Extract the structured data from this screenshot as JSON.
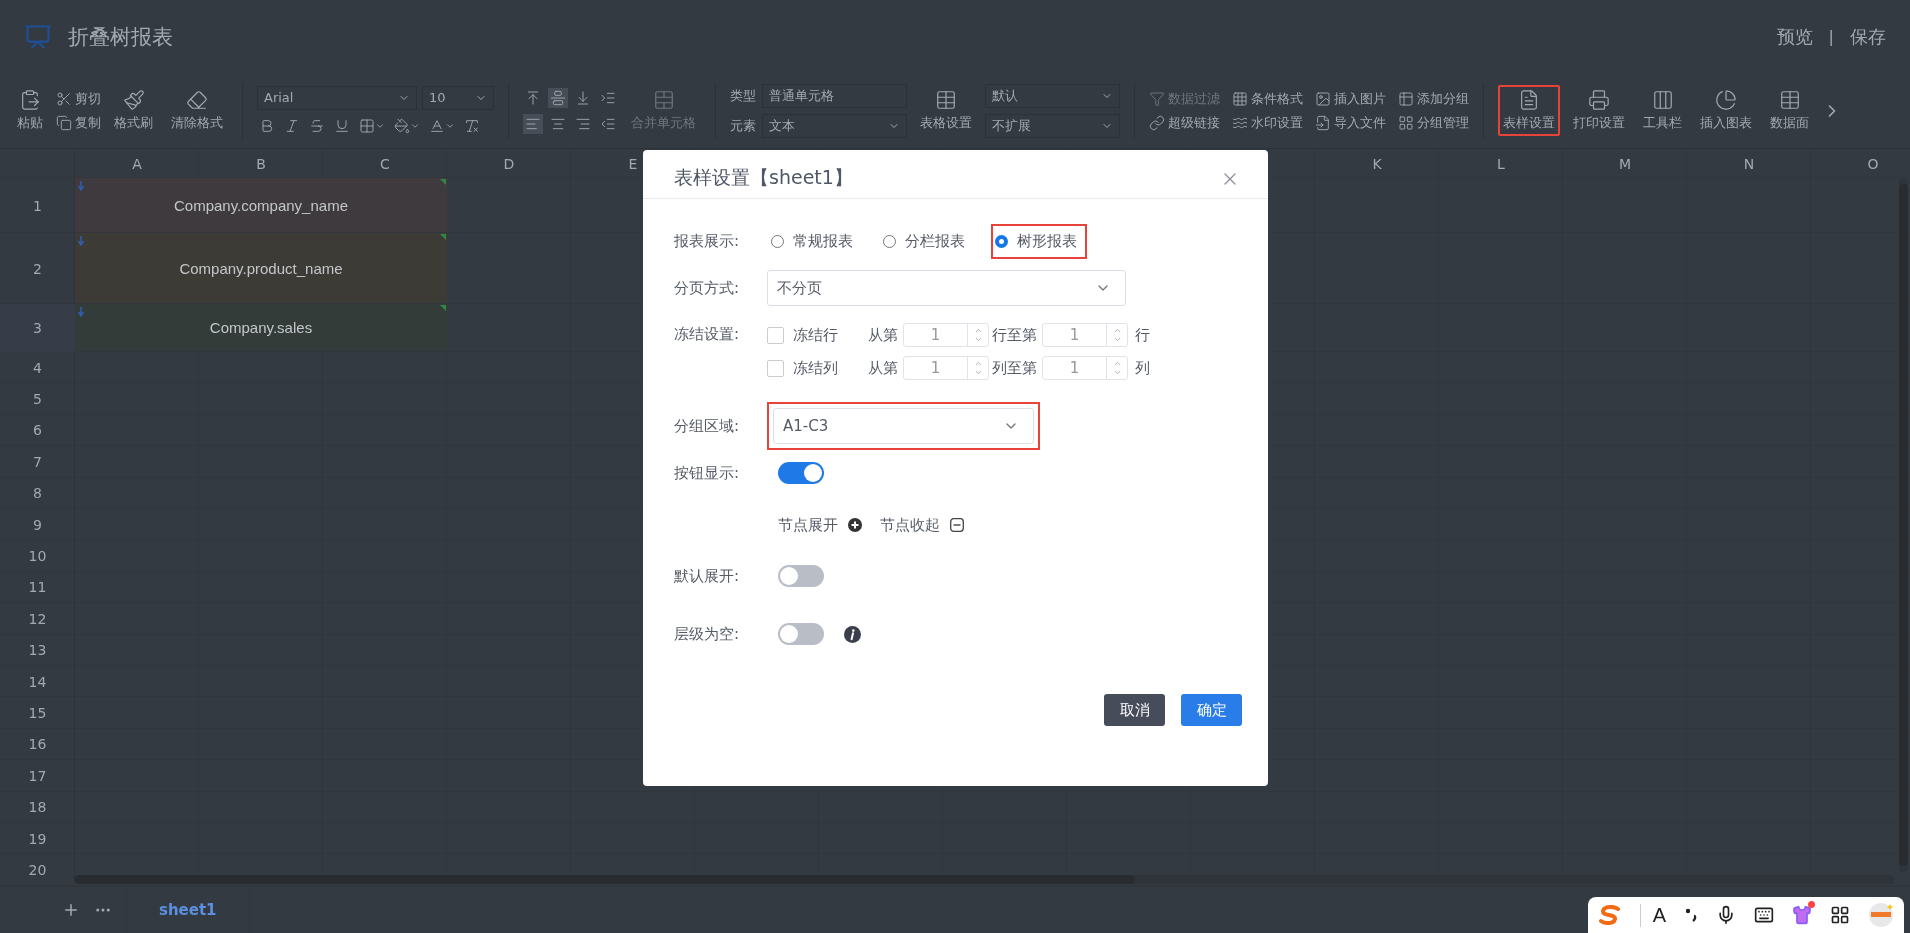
{
  "app": {
    "title": "折叠树报表",
    "actions": [
      "预览",
      "保存"
    ],
    "separator": "|"
  },
  "toolbar": {
    "paste": "粘贴",
    "clipboard": [
      "剪切",
      "复制"
    ],
    "format_painter": "格式刷",
    "clear_format": "清除格式",
    "font_family": "Arial",
    "font_size": "10",
    "vertical_align": [
      {
        "selected": false
      },
      {
        "selected": true
      },
      {
        "selected": false
      }
    ],
    "horizontal_align": [
      {
        "selected": true
      },
      {
        "selected": false
      },
      {
        "selected": false
      }
    ],
    "merge_cells": {
      "label": "合并单元格",
      "disabled": true
    },
    "cell_type": [
      {
        "label": "类型",
        "value": "普通单元格"
      },
      {
        "label": "元素",
        "value": "文本"
      }
    ],
    "table_settings": "表格设置",
    "expand_selects": [
      "默认",
      "不扩展"
    ],
    "tools": [
      {
        "label": "数据过滤",
        "disabled": true
      },
      {
        "label": "条件格式",
        "disabled": false
      },
      {
        "label": "插入图片",
        "disabled": false
      },
      {
        "label": "添加分组",
        "disabled": false
      },
      {
        "label": "超级链接",
        "disabled": false
      },
      {
        "label": "水印设置",
        "disabled": false
      },
      {
        "label": "导入文件",
        "disabled": false
      },
      {
        "label": "分组管理",
        "disabled": false
      }
    ],
    "big_tools": [
      {
        "label": "表样设置",
        "highlighted": true
      },
      {
        "label": "打印设置",
        "highlighted": false
      },
      {
        "label": "工具栏",
        "highlighted": false
      },
      {
        "label": "插入图表",
        "highlighted": false
      },
      {
        "label": "数据面",
        "highlighted": false
      }
    ]
  },
  "sheet": {
    "columns_left": [
      "A",
      "B",
      "C",
      "D",
      "E"
    ],
    "columns_right": [
      "K",
      "L",
      "M",
      "N",
      "O"
    ],
    "rows": [
      "1",
      "2",
      "3",
      "4",
      "5",
      "6",
      "7",
      "8",
      "9",
      "10",
      "11",
      "12",
      "13",
      "14",
      "15",
      "16",
      "17",
      "18",
      "19",
      "20"
    ],
    "cells": [
      {
        "text": "Company.company_name",
        "color": "#3e3a3d"
      },
      {
        "text": "Company.product_name",
        "color": "#3d3b35"
      },
      {
        "text": "Company.sales",
        "color": "#343c39"
      }
    ],
    "tabs": [
      {
        "label": "sheet1",
        "selected": true
      }
    ]
  },
  "dialog": {
    "title": "表样设置【sheet1】",
    "display": {
      "label": "报表展示:",
      "options": [
        {
          "label": "常规报表",
          "selected": false,
          "highlighted": false
        },
        {
          "label": "分栏报表",
          "selected": false,
          "highlighted": false
        },
        {
          "label": "树形报表",
          "selected": true,
          "highlighted": true
        }
      ]
    },
    "paging": {
      "label": "分页方式:",
      "value": "不分页"
    },
    "freeze": {
      "label": "冻结设置:",
      "rows": [
        {
          "label": "冻结行",
          "checked": false,
          "from_label": "从第",
          "from_value": "1",
          "to_label": "行至第",
          "to_value": "1",
          "unit": "行"
        },
        {
          "label": "冻结列",
          "checked": false,
          "from_label": "从第",
          "from_value": "1",
          "to_label": "列至第",
          "to_value": "1",
          "unit": "列"
        }
      ]
    },
    "group_area": {
      "label": "分组区域:",
      "value": "A1-C3",
      "highlighted": true
    },
    "button_display": {
      "label": "按钮显示:",
      "on": true
    },
    "legend": {
      "expand": "节点展开",
      "collapse": "节点收起"
    },
    "default_expand": {
      "label": "默认展开:",
      "on": false
    },
    "empty_level": {
      "label": "层级为空:",
      "on": false
    },
    "buttons": [
      {
        "label": "取消",
        "kind": "secondary"
      },
      {
        "label": "确定",
        "kind": "primary"
      }
    ]
  },
  "ime_bar": {
    "letter": "A"
  }
}
